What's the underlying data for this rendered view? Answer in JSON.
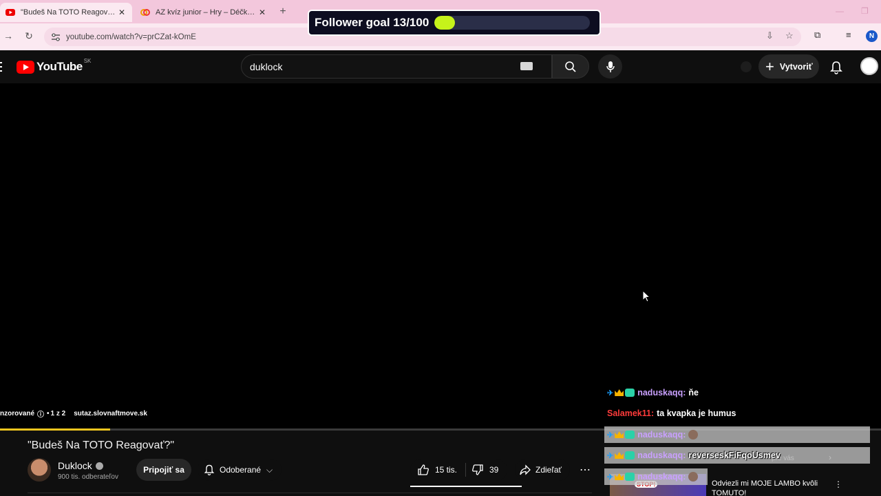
{
  "browser": {
    "tabs": [
      {
        "title": "\"Budeš Na TOTO Reagovať?\" - Y",
        "active": true
      },
      {
        "title": "AZ kvíz junior – Hry – Déčko – Č",
        "active": false
      }
    ],
    "new_tab_label": "+",
    "url": "youtube.com/watch?v=prCZat-kOmE",
    "profile_initial": "N"
  },
  "overlay": {
    "follower_goal_text": "Follower goal 13/100",
    "current": 13,
    "goal": 100
  },
  "youtube": {
    "logo_text": "YouTube",
    "country_code": "SK",
    "search_query": "duklock",
    "create_label": "Vytvoriť"
  },
  "video": {
    "ad_label": "nzorované",
    "ad_count": "1 z 2",
    "ad_link": "sutaz.slovnaftmove.sk",
    "title": "\"Budeš Na TOTO Reagovať?\"",
    "channel": "Duklock",
    "subscribers": "900 tis. odberateľov",
    "join_label": "Pripojiť sa",
    "subscribed_label": "Odoberané",
    "likes": "15 tis.",
    "dislikes": "39",
    "share_label": "Zdieľať"
  },
  "recommended": {
    "chip_1": "pre vás",
    "video_title": "Odviezli mi MOJE LAMBO kvôli TOMUTO!",
    "badge_text": "STOP!"
  },
  "chat": [
    {
      "user": "naduskaqq:",
      "text": "ňe",
      "user_color": "#c9a0ff",
      "badges": true,
      "boxed": false
    },
    {
      "user": "Salamek11:",
      "text": "ta kvapka je humus",
      "user_color": "#ff3b3b",
      "badges": false,
      "boxed": false
    },
    {
      "user": "naduskaqq:",
      "text": "",
      "user_color": "#c9a0ff",
      "badges": true,
      "boxed": true
    },
    {
      "user": "naduskaqq:",
      "text": "reverseskFiFqoUsmev",
      "user_color": "#c9a0ff",
      "badges": true,
      "boxed": true
    },
    {
      "user": "naduskaqq:",
      "text": "",
      "user_color": "#c9a0ff",
      "badges": true,
      "boxed": true
    }
  ]
}
